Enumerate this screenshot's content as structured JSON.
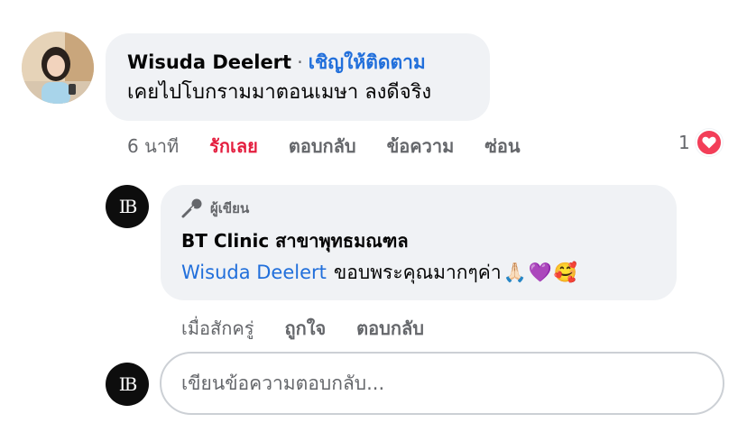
{
  "comment": {
    "author": "Wisuda Deelert",
    "separator": "·",
    "follow_label": "เชิญให้ติดตาม",
    "text": "เคยไปโบกรามมาตอนเมษา ลงดีจริง",
    "actions": {
      "time": "6 นาที",
      "love": "รักเลย",
      "reply": "ตอบกลับ",
      "message": "ข้อความ",
      "hide": "ซ่อน"
    },
    "reaction_count": "1",
    "reaction_icon": "love-reaction-icon",
    "reaction_color": "#f33e58"
  },
  "reply": {
    "badge": "ผู้เขียน",
    "badge_icon": "microphone-icon",
    "author": "BT Clinic สาขาพุทธมณฑล",
    "mention": "Wisuda Deelert",
    "text": "ขอบพระคุณมากๆค่า",
    "emojis": [
      "🙏🏻",
      "💜",
      "🥰"
    ],
    "avatar_monogram": "IB",
    "actions": {
      "time": "เมื่อสักครู่",
      "like": "ถูกใจ",
      "reply": "ตอบกลับ"
    }
  },
  "composer": {
    "placeholder": "เขียนข้อความตอบกลับ..."
  },
  "colors": {
    "link_blue": "#216fdb",
    "love_red": "#e41e3f",
    "muted_gray": "#65676b",
    "bubble_bg": "#f0f2f5"
  }
}
